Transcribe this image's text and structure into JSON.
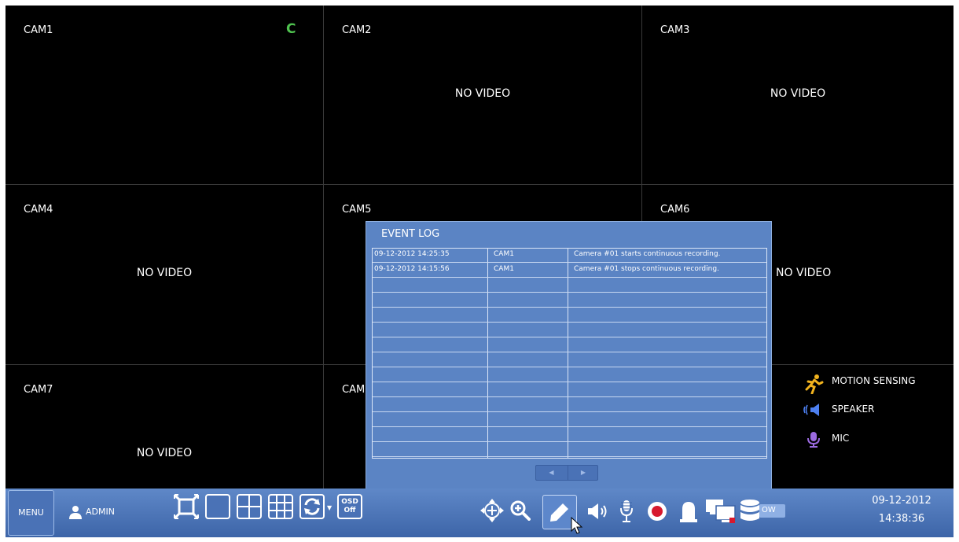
{
  "cameras": [
    {
      "label": "CAM1",
      "status": "",
      "badge": "C"
    },
    {
      "label": "CAM2",
      "status": "NO VIDEO"
    },
    {
      "label": "CAM3",
      "status": "NO VIDEO"
    },
    {
      "label": "CAM4",
      "status": "NO VIDEO"
    },
    {
      "label": "CAM5",
      "status": ""
    },
    {
      "label": "CAM6",
      "status": "NO VIDEO"
    },
    {
      "label": "CAM7",
      "status": "NO VIDEO"
    },
    {
      "label": "CAM",
      "status": ""
    }
  ],
  "event_log": {
    "title": "EVENT LOG",
    "rows": [
      {
        "time": "09-12-2012  14:25:35",
        "camera": "CAM1",
        "event": "Camera #01 starts continuous recording."
      },
      {
        "time": "09-12-2012  14:15:56",
        "camera": "CAM1",
        "event": "Camera #01 stops continuous recording."
      }
    ],
    "empty_rows": 12,
    "pager": {
      "prev": "◀",
      "next": "▶"
    }
  },
  "legend": [
    {
      "label": "MOTION SENSING",
      "icon": "running-man-icon",
      "color": "#f2b31e"
    },
    {
      "label": "SPEAKER",
      "icon": "speaker-icon",
      "color": "#4d7ff0"
    },
    {
      "label": "MIC",
      "icon": "mic-icon",
      "color": "#9b6ae0"
    }
  ],
  "toolbar": {
    "menu_label": "MENU",
    "user_label": "ADMIN",
    "osd_label_1": "OSD",
    "osd_label_2": "Off",
    "storage_label": "OW",
    "date": "09-12-2012",
    "time": "14:38:36",
    "icons": [
      "fullscreen-icon",
      "layout-1-icon",
      "layout-4-icon",
      "layout-9-icon",
      "sequence-icon",
      "osd-icon",
      "ptz-icon",
      "zoom-icon",
      "pen-icon",
      "audio-icon",
      "mic-icon",
      "record-icon",
      "alarm-icon",
      "monitor-icon",
      "storage-icon"
    ]
  },
  "colors": {
    "accent": "#4a72b6",
    "record": "#d7192e",
    "recorded_badge": "#4fc24f"
  }
}
